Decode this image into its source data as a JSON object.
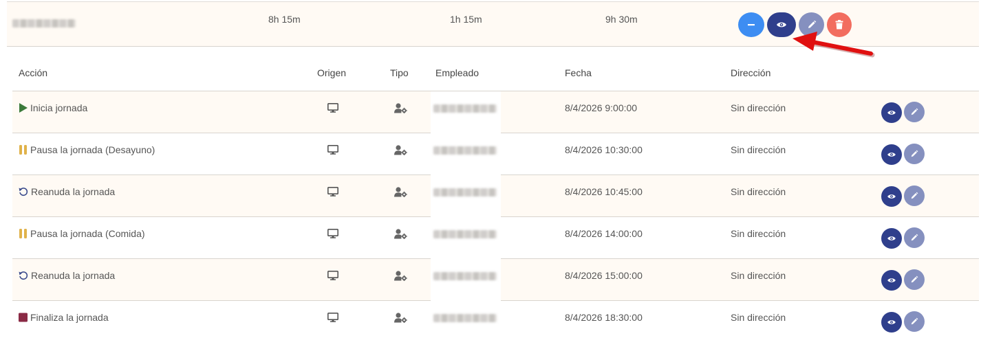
{
  "summary": {
    "worked": "8h 15m",
    "breaks": "1h 15m",
    "total": "9h 30m",
    "icons": {
      "collapse": "minus-icon",
      "view": "eye-icon",
      "edit": "pencil-icon",
      "delete": "trash-icon"
    }
  },
  "table": {
    "headers": {
      "accion": "Acción",
      "origen": "Origen",
      "tipo": "Tipo",
      "empleado": "Empleado",
      "fecha": "Fecha",
      "direccion": "Dirección"
    },
    "rows": [
      {
        "action": "Inicia jornada",
        "action_icon": "play-icon",
        "icon_color": "#3b7a3b",
        "origin_icon": "monitor-icon",
        "type_icon": "user-gear-icon",
        "date": "8/4/2026 9:00:00",
        "address": "Sin dirección"
      },
      {
        "action": "Pausa la jornada (Desayuno)",
        "action_icon": "pause-icon",
        "icon_color": "#e0b24a",
        "origin_icon": "monitor-icon",
        "type_icon": "user-gear-icon",
        "date": "8/4/2026 10:30:00",
        "address": "Sin dirección"
      },
      {
        "action": "Reanuda la jornada",
        "action_icon": "resume-icon",
        "icon_color": "#3a4a8c",
        "origin_icon": "monitor-icon",
        "type_icon": "user-gear-icon",
        "date": "8/4/2026 10:45:00",
        "address": "Sin dirección"
      },
      {
        "action": "Pausa la jornada (Comida)",
        "action_icon": "pause-icon",
        "icon_color": "#e0b24a",
        "origin_icon": "monitor-icon",
        "type_icon": "user-gear-icon",
        "date": "8/4/2026 14:00:00",
        "address": "Sin dirección"
      },
      {
        "action": "Reanuda la jornada",
        "action_icon": "resume-icon",
        "icon_color": "#3a4a8c",
        "origin_icon": "monitor-icon",
        "type_icon": "user-gear-icon",
        "date": "8/4/2026 15:00:00",
        "address": "Sin dirección"
      },
      {
        "action": "Finaliza la jornada",
        "action_icon": "stop-icon",
        "icon_color": "#8a2a45",
        "origin_icon": "monitor-icon",
        "type_icon": "user-gear-icon",
        "date": "8/4/2026 18:30:00",
        "address": "Sin dirección"
      }
    ]
  },
  "colors": {
    "view_button": "#2f3f8c",
    "edit_button": "#8590bf",
    "collapse_button": "#3d8df2",
    "delete_button": "#f26d5f",
    "row_tint": "#fffaf4",
    "annotation_arrow": "#e01010"
  }
}
